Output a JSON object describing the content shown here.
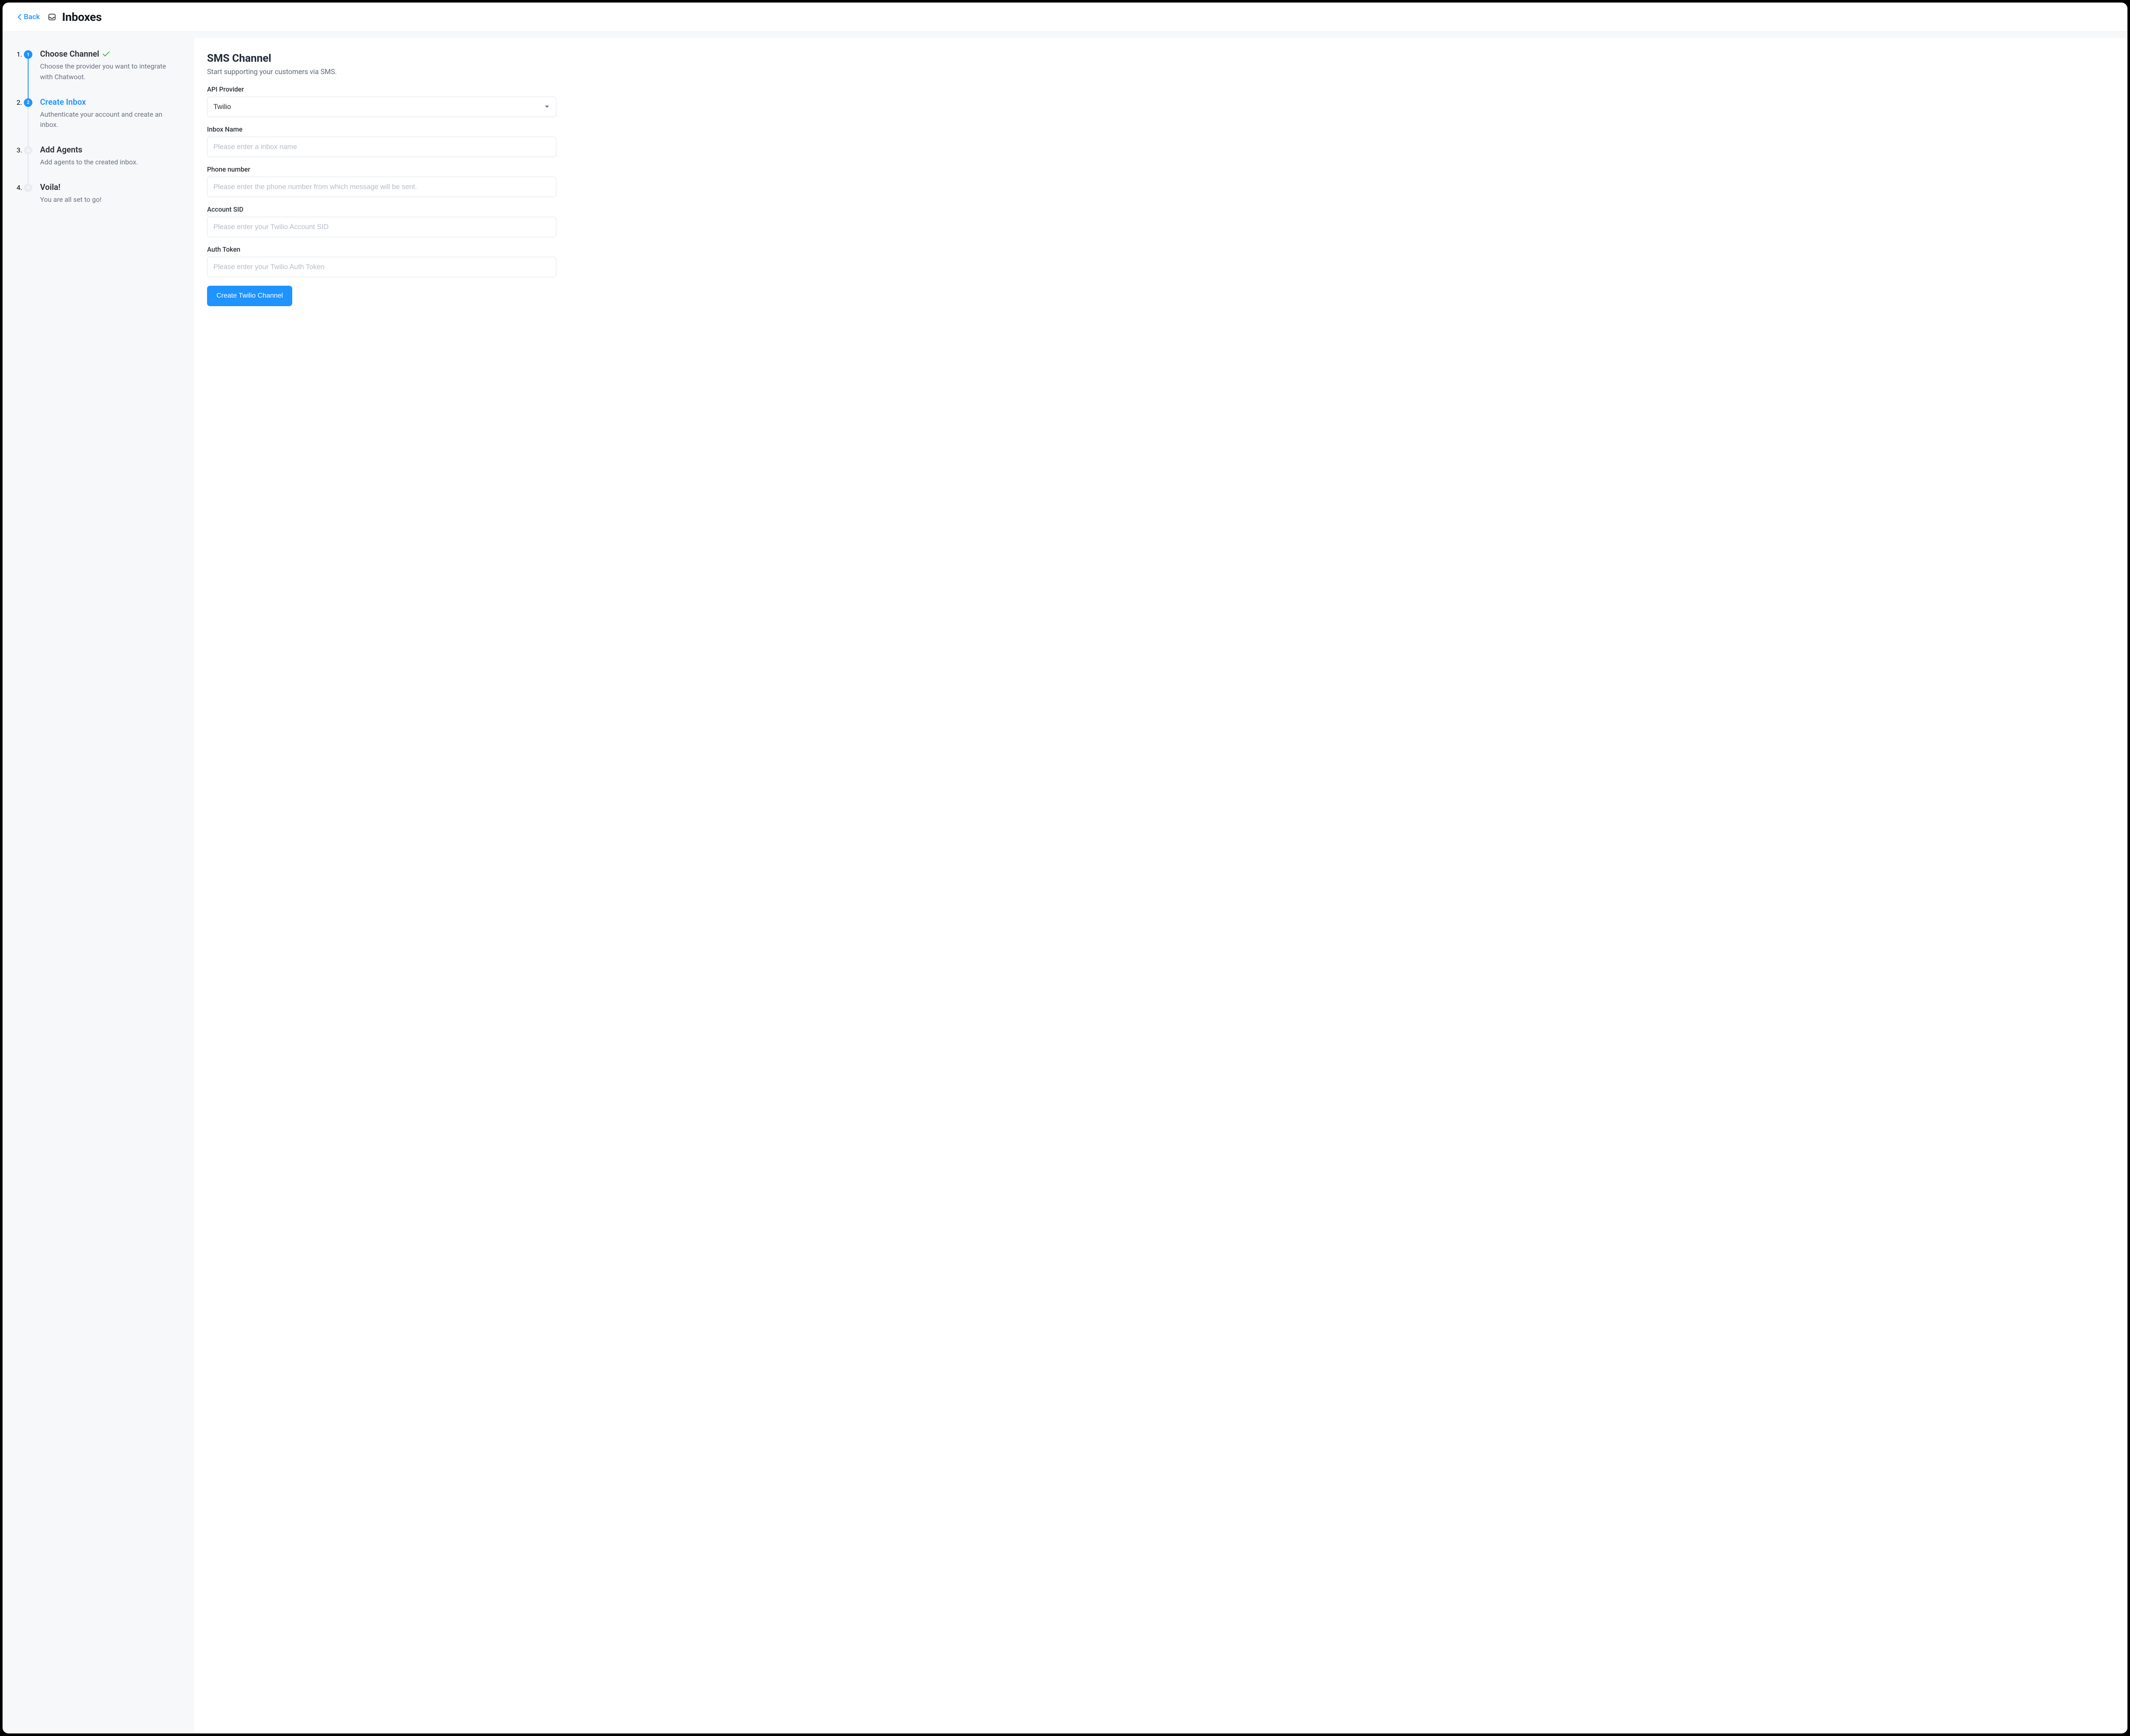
{
  "header": {
    "back_label": "Back",
    "title": "Inboxes"
  },
  "steps": [
    {
      "num": "1",
      "title": "Choose Channel",
      "desc": "Choose the provider you want to integrate with Chatwoot.",
      "state": "done"
    },
    {
      "num": "2",
      "title": "Create Inbox",
      "desc": "Authenticate your account and create an inbox.",
      "state": "active"
    },
    {
      "num": "3",
      "title": "Add Agents",
      "desc": "Add agents to the created inbox.",
      "state": "pending"
    },
    {
      "num": "4",
      "title": "Voila!",
      "desc": "You are all set to go!",
      "state": "pending"
    }
  ],
  "form": {
    "title": "SMS Channel",
    "subtitle": "Start supporting your customers via SMS.",
    "api_provider": {
      "label": "API Provider",
      "value": "Twilio"
    },
    "inbox_name": {
      "label": "Inbox Name",
      "placeholder": "Please enter a inbox name",
      "value": ""
    },
    "phone_number": {
      "label": "Phone number",
      "placeholder": "Please enter the phone number from which message will be sent.",
      "value": ""
    },
    "account_sid": {
      "label": "Account SID",
      "placeholder": "Please enter your Twilio Account SID",
      "value": ""
    },
    "auth_token": {
      "label": "Auth Token",
      "placeholder": "Please enter your Twilio Auth Token",
      "value": ""
    },
    "submit_label": "Create Twilio Channel"
  }
}
